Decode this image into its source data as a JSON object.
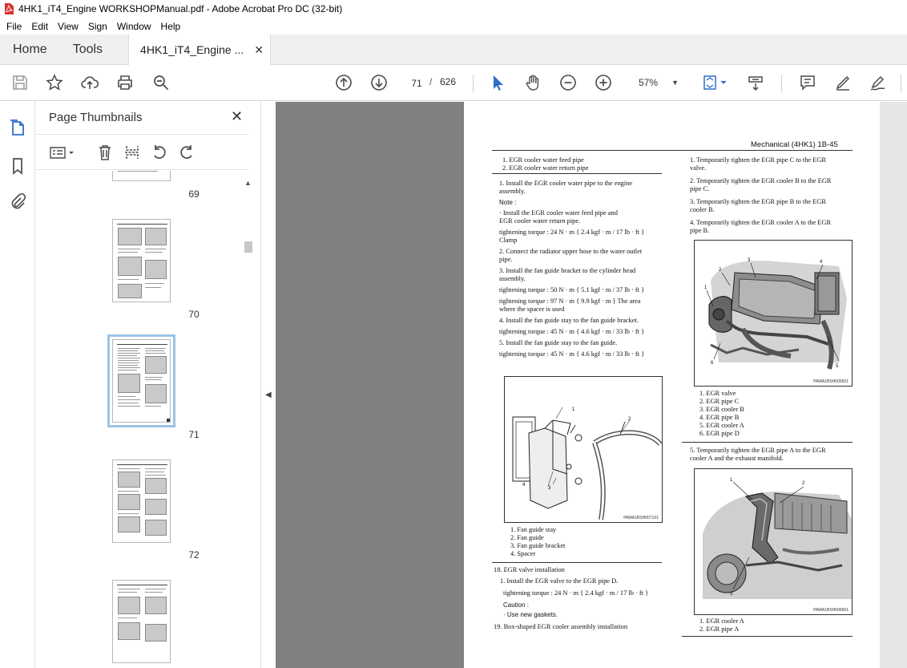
{
  "window": {
    "title": "4HK1_iT4_Engine WORKSHOPManual.pdf - Adobe Acrobat Pro DC (32-bit)"
  },
  "menu": [
    "File",
    "Edit",
    "View",
    "Sign",
    "Window",
    "Help"
  ],
  "tabs": {
    "home": "Home",
    "tools": "Tools",
    "document": "4HK1_iT4_Engine ...",
    "close_glyph": "✕"
  },
  "toolbar": {
    "current_page": "71",
    "page_separator": "/",
    "total_pages": "626",
    "zoom": "57%"
  },
  "panel": {
    "title": "Page Thumbnails",
    "thumbnails": [
      {
        "label": "69"
      },
      {
        "label": "70"
      },
      {
        "label": "71",
        "selected": true
      },
      {
        "label": "72"
      }
    ]
  },
  "page": {
    "running_head": "Mechanical (4HK1)   1B-45",
    "left_column": {
      "top_list": [
        "1.   EGR cooler water feed pipe",
        "2.   EGR cooler water return pipe"
      ],
      "steps": [
        "1.   Install the EGR cooler water pipe to the engine",
        "      assembly.",
        "Note :",
        "·    Install the EGR cooler water feed pipe and",
        "      EGR cooler water return pipe.",
        "tightening torque :  24 N · m { 2.4 kgf · m / 17 lb · ft }",
        "Clamp",
        "2.   Connect the radiator upper hose to the water outlet",
        "      pipe.",
        "3.   Install the fan guide bracket to the cylinder head",
        "      assembly.",
        "tightening torque :  50 N · m { 5.1 kgf · m / 37 lb · ft }",
        "tightening torque :  97 N · m { 9.9 kgf · m } The area",
        "where the spacer is used",
        "4.   Install the fan guide stay to the fan guide bracket.",
        "tightening torque :  45 N · m { 4.6 kgf · m / 33 lb · ft }",
        "5.   Install the fan guide stay to the fan guide.",
        "tightening torque :  45 N · m { 4.6 kgf · m / 33 lb · ft }"
      ],
      "figure_code": "PAWA1BSH007101",
      "figure_list": [
        "1.   Fan guide stay",
        "2.   Fan guide",
        "3.   Fan guide bracket",
        "4.   Spacer"
      ],
      "section_18": "18.  EGR valve  installation",
      "section_18_steps": [
        "1.   Install the EGR valve to the EGR pipe D.",
        "tightening torque :  24 N · m { 2.4 kgf · m / 17 lb · ft }",
        "Caution :",
        "·    Use new gaskets."
      ],
      "section_19": "19.  Box-shaped EGR cooler assembly  installation"
    },
    "right_column": {
      "steps": [
        "1.   Temporarily tighten the EGR pipe C to the EGR",
        "      valve.",
        "2.   Temporarily tighten the EGR cooler B to the EGR",
        "      pipe C.",
        "3.   Temporarily tighten the EGR pipe B to the EGR",
        "      cooler B.",
        "4.   Temporarily tighten the EGR cooler A to the EGR",
        "      pipe B."
      ],
      "figure1_code": "PAWA1BSH006501",
      "figure1_list": [
        "1.   EGR valve",
        "2.   EGR pipe C",
        "3.   EGR cooler B",
        "4.   EGR pipe B",
        "5.   EGR cooler A",
        "6.   EGR pipe D"
      ],
      "step5": [
        "5.   Temporarily tighten the EGR pipe A to the EGR",
        "      cooler A and the exhaust manifold."
      ],
      "figure2_code": "PAWA1BSH006601",
      "figure2_list": [
        "1.   EGR cooler A",
        "2.   EGR pipe A"
      ]
    },
    "callouts": {
      "fig_left": [
        "1",
        "2",
        "3",
        "4"
      ],
      "fig_right1": [
        "1",
        "2",
        "3",
        "4",
        "5",
        "6"
      ],
      "fig_right2": [
        "1",
        "2",
        "3"
      ]
    }
  },
  "colors": {
    "acrobat_red": "#d7312b",
    "toolbar_icon": "#4b4b4b",
    "select_blue": "#2d6eca",
    "canvas_gray": "#808080"
  }
}
